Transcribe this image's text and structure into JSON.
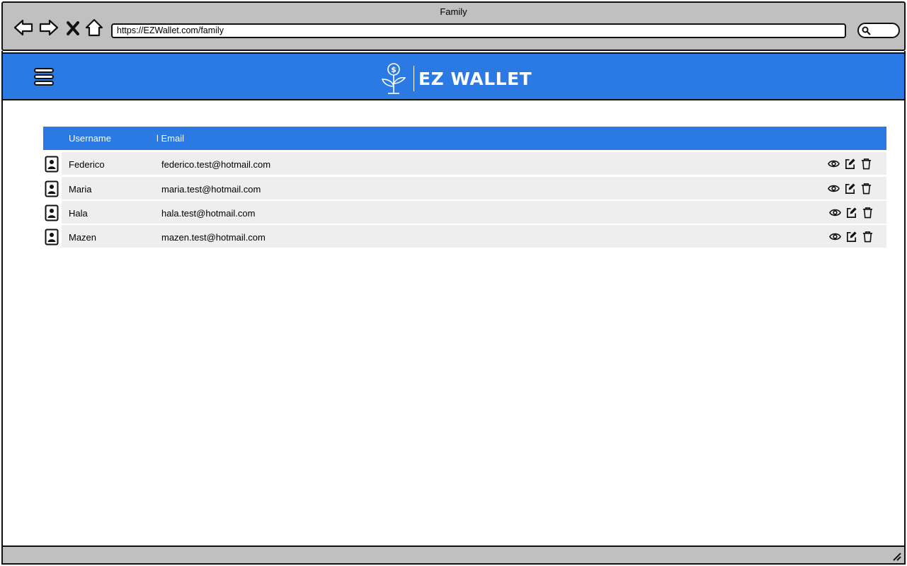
{
  "browser": {
    "window_title": "Family",
    "url": "https://EZWallet.com/family",
    "nav_icons": [
      "back-arrow-icon",
      "forward-arrow-icon",
      "close-x-icon",
      "home-icon"
    ]
  },
  "header": {
    "brand": "EZ WALLET",
    "brand_color": "#2b79e3"
  },
  "table": {
    "columns": [
      "Username",
      "l Email"
    ],
    "rows": [
      {
        "username": "Federico",
        "email": "federico.test@hotmail.com"
      },
      {
        "username": "Maria",
        "email": "maria.test@hotmail.com"
      },
      {
        "username": "Hala",
        "email": "hala.test@hotmail.com"
      },
      {
        "username": "Mazen",
        "email": "mazen.test@hotmail.com"
      }
    ],
    "row_actions": [
      "eye-icon",
      "edit-icon",
      "trash-icon"
    ]
  }
}
